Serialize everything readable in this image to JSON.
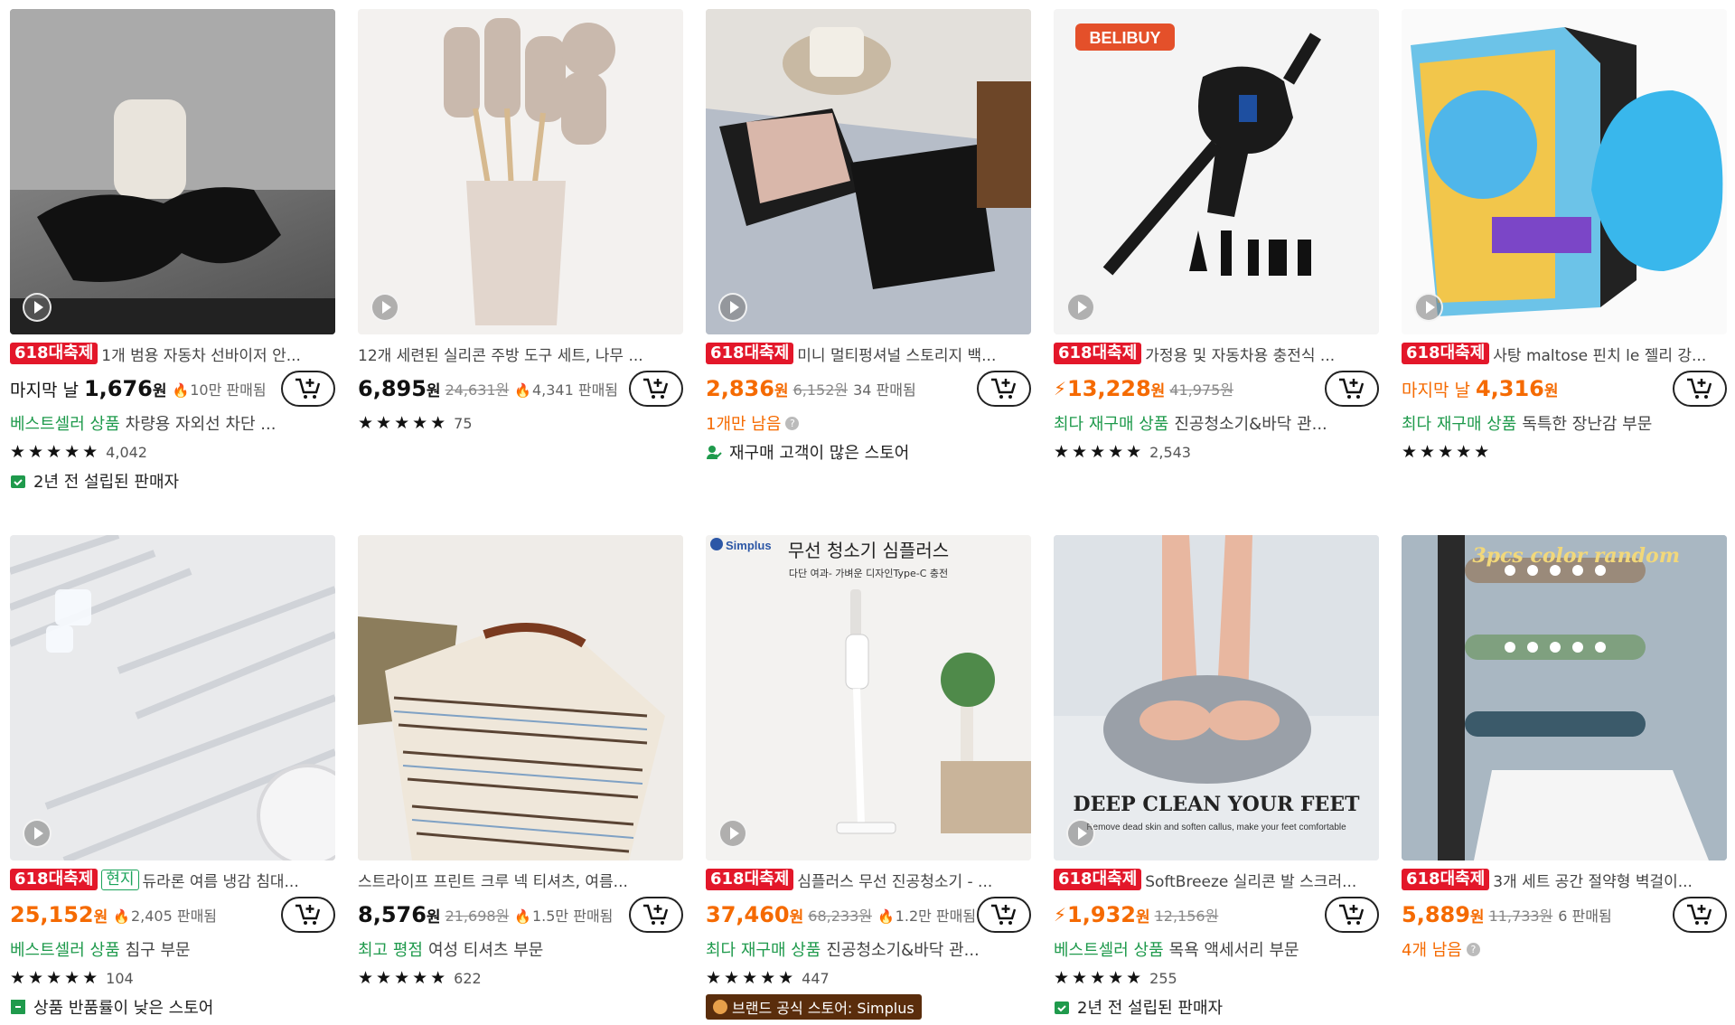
{
  "products": [
    {
      "badge": "618대축제",
      "title": "1개 범용 자동차 선바이저 안...",
      "prefix": "마지막 날",
      "price": "1,676",
      "won": "원",
      "sold": "10만 판매됨",
      "line3_tag": "베스트셀러 상품",
      "line3_text": "차량용 자외선 차단 ...",
      "reviews": "4,042",
      "stars": "★★★★★",
      "seller": "2년 전 설립된 판매자"
    },
    {
      "title": "12개 세련된 실리콘 주방 도구 세트, 나무 ...",
      "price": "6,895",
      "won": "원",
      "orig": "24,631원",
      "sold": "4,341 판매됨",
      "stars": "★★★★★",
      "reviews": "75"
    },
    {
      "badge": "618대축제",
      "title": "미니 멀티펑셔널 스토리지 백...",
      "price": "2,836",
      "won": "원",
      "orig": "6,152원",
      "sold": "34 판매됨",
      "note": "1개만 남음",
      "stars": "",
      "seller": "재구매 고객이 많은 스토어"
    },
    {
      "badge": "618대축제",
      "title": "가정용 및 자동차용 충전식 ...",
      "price": "13,228",
      "won": "원",
      "orig": "41,975원",
      "line3_tag": "최다 재구매 상품",
      "line3_text": "진공청소기&바닥 관...",
      "stars": "★★★★★",
      "reviews": "2,543"
    },
    {
      "badge": "618대축제",
      "title": "사탕 maltose 핀치 le 젤리 강...",
      "prefix": "마지막 날",
      "price": "4,316",
      "won": "원",
      "line3_tag": "최다 재구매 상품",
      "line3_text": "독특한 장난감 부문",
      "stars": "★★★★★"
    },
    {
      "badge": "618대축제",
      "badge2": "현지",
      "title": "듀라론 여름 냉감 침대...",
      "price": "25,152",
      "won": "원",
      "sold": "2,405 판매됨",
      "line3_tag": "베스트셀러 상품",
      "line3_text": "침구 부문",
      "stars": "★★★★★",
      "reviews": "104",
      "seller": "상품 반품률이 낮은 스토어"
    },
    {
      "title": "스트라이프 프린트 크루 넥 티셔츠, 여름...",
      "price": "8,576",
      "won": "원",
      "orig": "21,698원",
      "sold": "1.5만 판매됨",
      "line3_tag": "최고 평점",
      "line3_text": "여성 티셔츠 부문",
      "stars": "★★★★★",
      "reviews": "622"
    },
    {
      "badge": "618대축제",
      "title": "심플러스 무선 진공청소기 - ...",
      "price": "37,460",
      "won": "원",
      "orig": "68,233원",
      "sold": "1.2만 판매됨",
      "line3_tag": "최다 재구매 상품",
      "line3_text": "진공청소기&바닥 관...",
      "stars": "★★★★★",
      "reviews": "447",
      "brand": "브랜드 공식 스토어: Simplus",
      "img_brand": "Simplus",
      "img_title": "무선 청소기 심플러스",
      "img_sub": "다단 여과- 가벼운 디자인Type-C 충전"
    },
    {
      "badge": "618대축제",
      "title": "SoftBreeze 실리콘 발 스크러...",
      "price": "1,932",
      "won": "원",
      "orig": "12,156원",
      "line3_tag": "베스트셀러 상품",
      "line3_text": "목욕 액세서리 부문",
      "stars": "★★★★★",
      "reviews": "255",
      "seller": "2년 전 설립된 판매자",
      "img_title": "DEEP CLEAN YOUR FEET",
      "img_sub": "Remove dead skin and soften callus, make your feet comfortable"
    },
    {
      "badge": "618대축제",
      "title": "3개 세트 공간 절약형 벽걸이...",
      "price": "5,889",
      "won": "원",
      "orig": "11,733원",
      "sold": "6 판매됨",
      "note": "4개 남음",
      "img_title": "3pcs color random"
    }
  ],
  "img_brand_belibuy": "BELIBUY",
  "colors": {
    "accent_red": "#e3172a",
    "orange": "#f56a00",
    "green": "#1f9a4c"
  }
}
